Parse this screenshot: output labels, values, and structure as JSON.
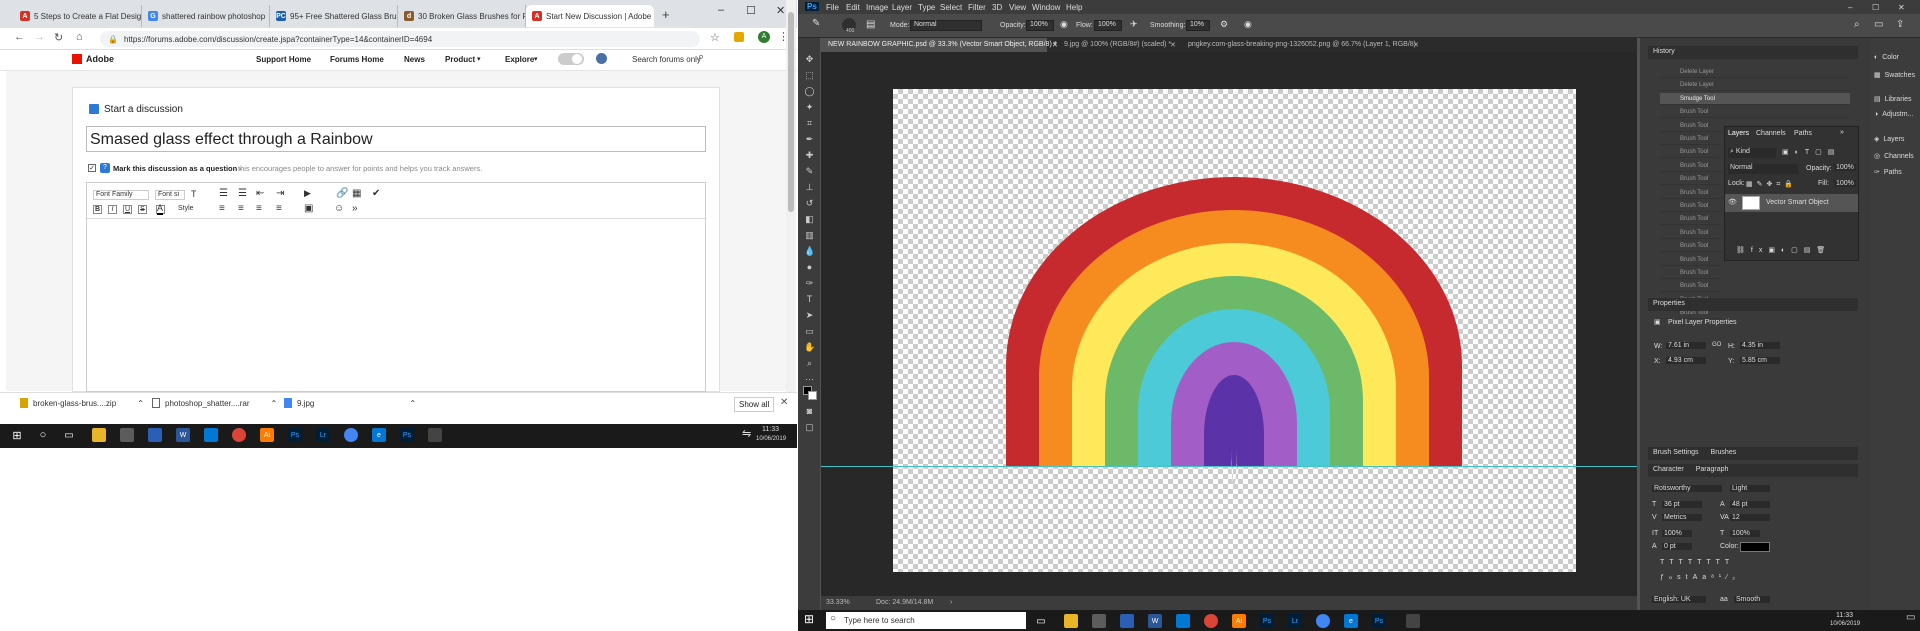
{
  "browser": {
    "tabs": [
      {
        "label": "5 Steps to Create a Flat Design",
        "color": "#d93025",
        "letter": "A"
      },
      {
        "label": "shattered rainbow photoshop",
        "color": "#4285f4",
        "letter": "G"
      },
      {
        "label": "95+ Free Shattered Glass Brus",
        "color": "#1a5fb4",
        "letter": "PC"
      },
      {
        "label": "30 Broken Glass Brushes for P",
        "color": "#8b5a2b",
        "letter": "d"
      },
      {
        "label": "Start New Discussion | Adobe",
        "color": "#d93025",
        "letter": "A"
      }
    ],
    "new_tab": "+",
    "url": "https://forums.adobe.com/discussion/create.jspa?containerType=14&containerID=4694",
    "site": {
      "logo": "Adobe",
      "nav": [
        "Support Home",
        "Forums Home",
        "News",
        "Product",
        "Explore"
      ],
      "search_placeholder": "Search forums only"
    },
    "form": {
      "heading": "Start a discussion",
      "title_value": "Smased glass effect through a Rainbow",
      "question_label": "Mark this discussion as a question -",
      "question_hint": "this encourages people to answer for points and helps you track answers.",
      "font_family": "Font Family",
      "font_size": "Font si",
      "style": "Style",
      "bold": "B",
      "italic": "I",
      "underline": "U",
      "strike": "S"
    },
    "downloads": [
      {
        "name": "broken-glass-brus....zip"
      },
      {
        "name": "photoshop_shatter....rar"
      },
      {
        "name": "9.jpg"
      }
    ],
    "show_all": "Show all",
    "taskbar_time": "11:33",
    "taskbar_date": "10/06/2019"
  },
  "photoshop": {
    "menu": [
      "Ps",
      "File",
      "Edit",
      "Image",
      "Layer",
      "Type",
      "Select",
      "Filter",
      "3D",
      "View",
      "Window",
      "Help"
    ],
    "options": {
      "brush_size": "400",
      "mode_label": "Mode:",
      "mode_value": "Normal",
      "opacity_label": "Opacity:",
      "opacity_value": "100%",
      "flow_label": "Flow:",
      "flow_value": "100%",
      "smoothing_label": "Smoothing:",
      "smoothing_value": "10%"
    },
    "doc_tabs": [
      "NEW RAINBOW GRAPHIC.psd @ 33.3% (Vector Smart Object, RGB/8) *",
      "9.jpg @ 100% (RGB/8#) (scaled) *",
      "pngkey.com-glass-breaking-png-1326052.png @ 66.7% (Layer 1, RGB/8)"
    ],
    "status": {
      "zoom": "33.33%",
      "doc": "Doc: 24.9M/14.8M"
    },
    "history": {
      "title": "History",
      "items": [
        "Delete Layer",
        "Delete Layer",
        "Smudge Tool",
        "Brush Tool",
        "Brush Tool",
        "Brush Tool",
        "Brush Tool",
        "Brush Tool",
        "Brush Tool",
        "Brush Tool",
        "Brush Tool",
        "Brush Tool",
        "Brush Tool",
        "Brush Tool",
        "Brush Tool",
        "Brush Tool",
        "Brush Tool",
        "Brush Tool",
        "Brush Tool"
      ]
    },
    "layers": {
      "tabs": [
        "Layers",
        "Channels",
        "Paths"
      ],
      "kind": "Kind",
      "blend": "Normal",
      "opacity_label": "Opacity:",
      "opacity": "100%",
      "lock_label": "Lock:",
      "fill_label": "Fill:",
      "fill": "100%",
      "layer_name": "Vector Smart Object"
    },
    "properties": {
      "title": "Properties",
      "subtitle": "Pixel Layer Properties",
      "w_label": "W:",
      "w": "7.61 in",
      "go": "GO",
      "h_label": "H:",
      "h": "4.35 in",
      "x_label": "X:",
      "x": "4.93 cm",
      "y_label": "Y:",
      "y": "5.85 cm"
    },
    "character": {
      "tabs": [
        "Brush Settings",
        "Brushes"
      ],
      "char_tabs": [
        "Character",
        "Paragraph"
      ],
      "font": "Rotisworthy",
      "weight": "Light",
      "size": "36 pt",
      "leading": "48 pt",
      "kerning": "Metrics",
      "tracking": "12",
      "vscale": "100%",
      "hscale": "100%",
      "baseline": "0 pt",
      "color_label": "Color:",
      "lang": "English: UK",
      "aa": "Smooth"
    },
    "right_strip": [
      "Color",
      "Swatches",
      "Libraries",
      "Adjustm...",
      "Layers",
      "Channels",
      "Paths"
    ],
    "rainbow_colors": [
      "#c62a2e",
      "#f68b1f",
      "#fde95a",
      "#6cb96a",
      "#4ccad7",
      "#a35dc7",
      "#5b32a8"
    ],
    "taskbar": {
      "search": "Type here to search",
      "time": "11:33",
      "date": "10/06/2019"
    }
  }
}
